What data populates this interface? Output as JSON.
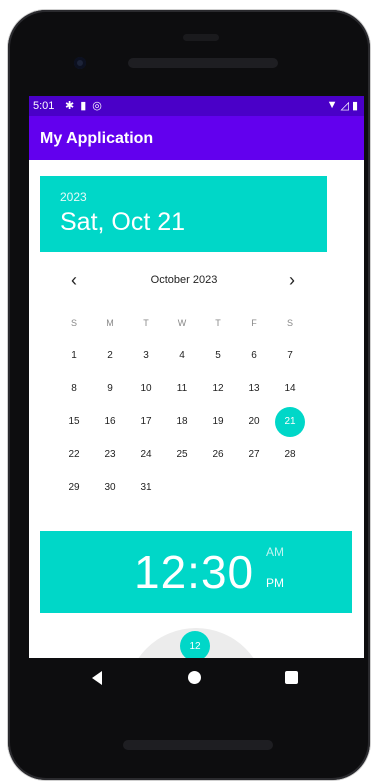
{
  "status_bar": {
    "time": "5:01",
    "left_icons": [
      "gear-icon",
      "sd-card-icon",
      "sync-icon"
    ],
    "right_icons": [
      "wifi-icon",
      "signal-icon",
      "battery-icon"
    ]
  },
  "app_bar": {
    "title": "My Application"
  },
  "date_picker": {
    "year": "2023",
    "selected_date": "Sat, Oct 21",
    "month_label": "October 2023",
    "prev_icon": "chevron-left-icon",
    "next_icon": "chevron-right-icon",
    "weekdays": [
      "S",
      "M",
      "T",
      "W",
      "T",
      "F",
      "S"
    ],
    "weeks": [
      [
        "1",
        "2",
        "3",
        "4",
        "5",
        "6",
        "7"
      ],
      [
        "8",
        "9",
        "10",
        "11",
        "12",
        "13",
        "14"
      ],
      [
        "15",
        "16",
        "17",
        "18",
        "19",
        "20",
        "21"
      ],
      [
        "22",
        "23",
        "24",
        "25",
        "26",
        "27",
        "28"
      ],
      [
        "29",
        "30",
        "31",
        "",
        "",
        "",
        ""
      ]
    ],
    "selected_day": "21",
    "accent_color": "#00d7c8"
  },
  "time_picker": {
    "time": "12:30",
    "am": "AM",
    "pm": "PM",
    "clock_marker": "12"
  },
  "nav_bar": {
    "back_icon": "back-icon",
    "home_icon": "home-icon",
    "recents_icon": "recents-icon"
  },
  "colors": {
    "status_bar": "#4a00c8",
    "app_bar": "#6200ee",
    "accent": "#00d7c8"
  }
}
